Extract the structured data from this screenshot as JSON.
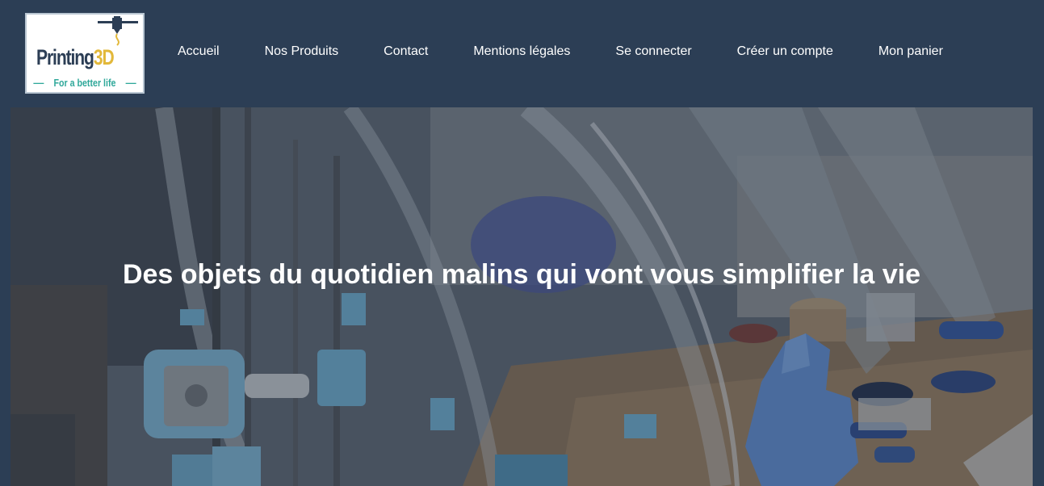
{
  "logo": {
    "brand_main": "Printing",
    "brand_accent": "3D",
    "tagline": "For a better life"
  },
  "nav": {
    "items": [
      {
        "label": "Accueil"
      },
      {
        "label": "Nos Produits"
      },
      {
        "label": "Contact"
      },
      {
        "label": "Mentions légales"
      },
      {
        "label": "Se connecter"
      },
      {
        "label": "Créer un compte"
      },
      {
        "label": "Mon panier"
      }
    ]
  },
  "hero": {
    "title": "Des objets du quotidien malins qui vont vous simplifier la vie",
    "image_icon": "3d-printer-photo"
  },
  "colors": {
    "header_bg": "#2c3e55",
    "logo_text": "#2c3e55",
    "logo_accent": "#e2b83a",
    "logo_tagline": "#2fa89a",
    "nav_text": "#ffffff"
  }
}
